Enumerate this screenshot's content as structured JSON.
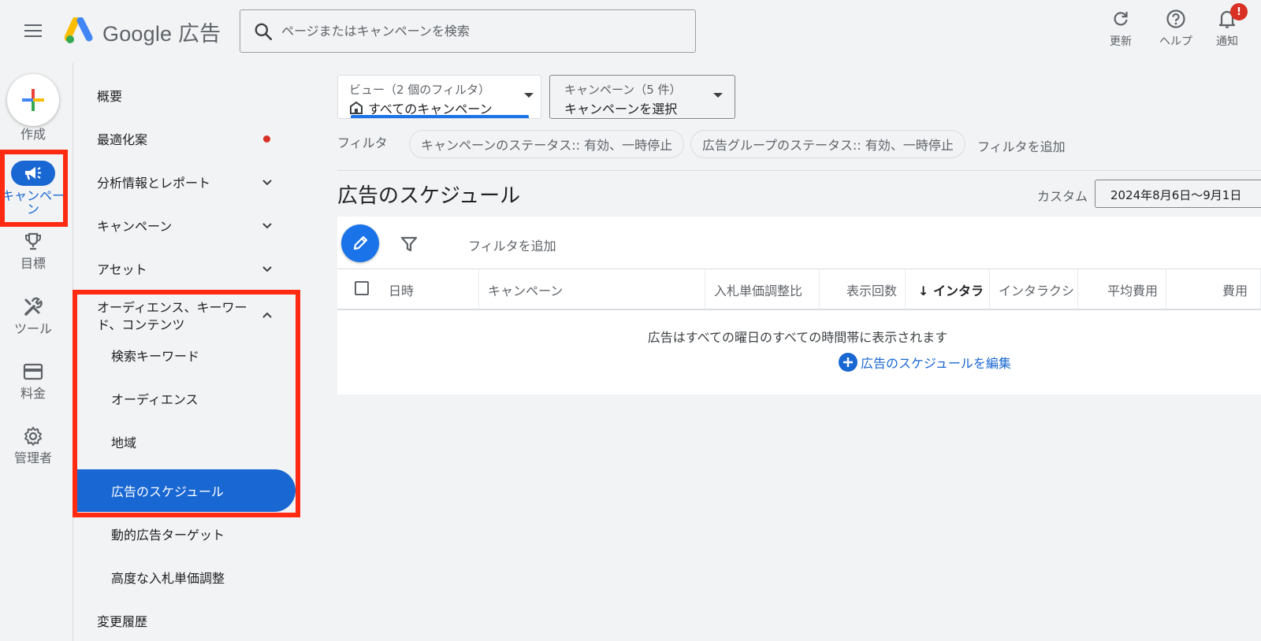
{
  "header": {
    "logo_text": "Google 広告",
    "search_placeholder": "ページまたはキャンペーンを検索",
    "actions": [
      {
        "label": "更新",
        "icon": "refresh-icon"
      },
      {
        "label": "ヘルプ",
        "icon": "help-icon"
      },
      {
        "label": "通知",
        "icon": "bell-icon",
        "badge": "!"
      }
    ]
  },
  "rail": {
    "create_label": "作成",
    "items": [
      {
        "label": "キャンペーン",
        "icon": "megaphone-icon",
        "active": true
      },
      {
        "label": "目標",
        "icon": "trophy-icon"
      },
      {
        "label": "ツール",
        "icon": "tools-icon"
      },
      {
        "label": "料金",
        "icon": "credit-card-icon"
      },
      {
        "label": "管理者",
        "icon": "gear-icon"
      }
    ]
  },
  "sidebar": {
    "items": [
      {
        "label": "概要"
      },
      {
        "label": "最適化案",
        "has_dot": true
      },
      {
        "label": "分析情報とレポート",
        "chevron": "down"
      },
      {
        "label": "キャンペーン",
        "chevron": "down"
      },
      {
        "label": "アセット",
        "chevron": "down"
      },
      {
        "label": "オーディエンス、キーワード、コンテンツ",
        "chevron": "up"
      },
      {
        "label": "検索キーワード",
        "sub": true
      },
      {
        "label": "オーディエンス",
        "sub": true
      },
      {
        "label": "地域",
        "sub": true
      },
      {
        "label": "広告のスケジュール",
        "sub": true,
        "active": true
      },
      {
        "label": "動的広告ターゲット",
        "sub": true
      },
      {
        "label": "高度な入札単価調整",
        "sub": true
      },
      {
        "label": "変更履歴"
      }
    ]
  },
  "view_selector": {
    "label": "ビュー（2 個のフィルタ）",
    "value": "すべてのキャンペーン"
  },
  "campaign_selector": {
    "label": "キャンペーン（5 件）",
    "value": "キャンペーンを選択"
  },
  "filters": {
    "label": "フィルタ",
    "chips": [
      "キャンペーンのステータス:: 有効、一時停止",
      "広告グループのステータス:: 有効、一時停止"
    ],
    "add_label": "フィルタを追加"
  },
  "page": {
    "title": "広告のスケジュール",
    "date_label": "カスタム",
    "date_range": "2024年8月6日〜9月1日"
  },
  "table": {
    "add_filter": "フィルタを追加",
    "columns": [
      "日時",
      "キャンペーン",
      "入札単価調整比",
      "表示回数",
      "↓ インタラ",
      "インタラクシ",
      "平均費用",
      "費用"
    ],
    "empty_message": "広告はすべての曜日のすべての時間帯に表示されます",
    "edit_link": "広告のスケジュールを編集"
  },
  "colors": {
    "accent": "#1967d2",
    "highlight_box": "#ff2a12",
    "alert": "#d93025"
  }
}
